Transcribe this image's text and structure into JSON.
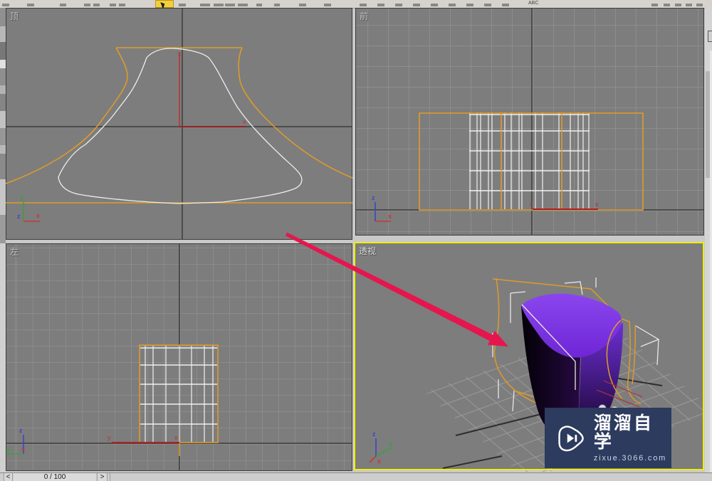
{
  "viewports": {
    "top": {
      "label": "顶"
    },
    "front": {
      "label": "前"
    },
    "left": {
      "label": "左"
    },
    "perspective": {
      "label": "透视"
    }
  },
  "axis": {
    "x": "x",
    "y": "y",
    "z": "z"
  },
  "toolbar": {
    "abc_label": "ABC",
    "active_tool": "select-object"
  },
  "time_slider": {
    "frame_display": "0 / 100",
    "prev_label": "<",
    "next_label": ">"
  },
  "watermark": {
    "title": "溜溜自学",
    "url": "zixue.3066.com",
    "icon": "play-logo"
  },
  "annotation": {
    "type": "arrow",
    "color": "#e5164e"
  },
  "colors": {
    "chrome": "#cdcdcd",
    "toolbar": "#d6d3ce",
    "viewport_bg": "#7d7d7d",
    "grid_line": "#8d8d8d",
    "axis_line": "#3c3c3c",
    "spline_orange": "#dd9b2b",
    "spline_white": "#ededed",
    "active_viewport_border": "#f0ec12",
    "selection_red": "#b02020",
    "arrow": "#e5164e",
    "object_top": "#7c35e6",
    "object_dark": "#0a0312",
    "object_right": "#4a1f9e",
    "watermark_bg": "#2c3b5e",
    "axis_x": "#c23a3a",
    "axis_y": "#3f9e3f",
    "axis_z": "#3947c8",
    "tool_highlight": "#f2cf3c"
  }
}
